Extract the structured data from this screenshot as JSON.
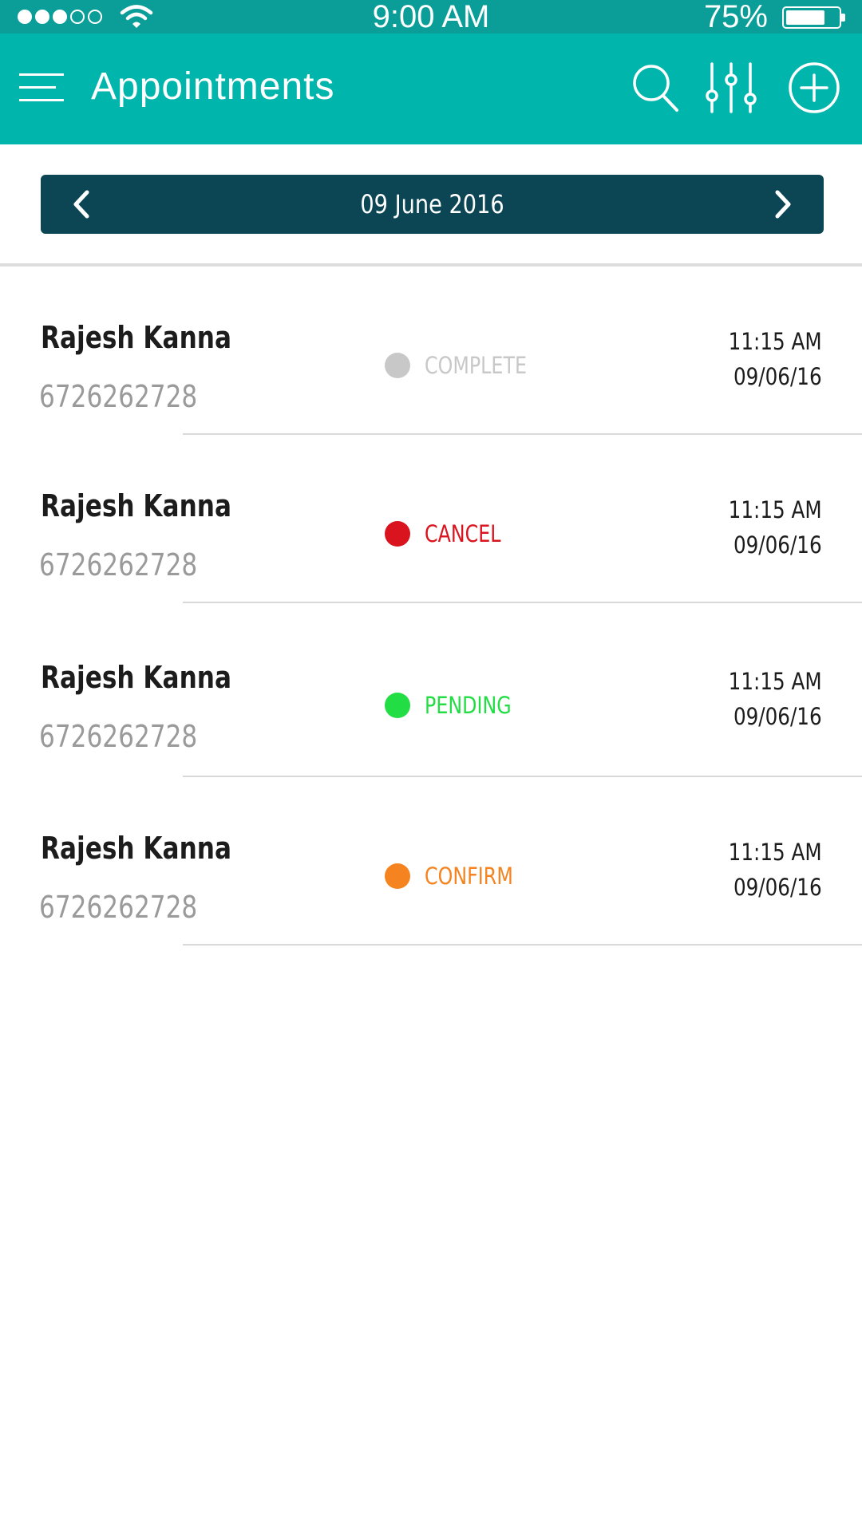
{
  "status_bar": {
    "time": "9:00 AM",
    "battery_percent": "75%",
    "battery_level": 0.75,
    "signal_bars_filled": 3,
    "signal_bars_total": 5
  },
  "app_bar": {
    "title": "Appointments",
    "icons": [
      "menu-icon",
      "search-icon",
      "filter-sliders-icon",
      "add-circle-icon"
    ],
    "background_color": "#00b5ab"
  },
  "date_nav": {
    "date": "09 June 2016",
    "background_color": "#0c4655"
  },
  "appointments": [
    {
      "name": "Rajesh Kanna",
      "phone": "6726262728",
      "status": "COMPLETE",
      "status_color": "#c8c8c8",
      "time": "11:15 AM",
      "date": "09/06/16"
    },
    {
      "name": "Rajesh Kanna",
      "phone": "6726262728",
      "status": "CANCEL",
      "status_color": "#d9141e",
      "time": "11:15 AM",
      "date": "09/06/16"
    },
    {
      "name": "Rajesh Kanna",
      "phone": "6726262728",
      "status": "PENDING",
      "status_color": "#22dd44",
      "time": "11:15 AM",
      "date": "09/06/16"
    },
    {
      "name": "Rajesh Kanna",
      "phone": "6726262728",
      "status": "CONFIRM",
      "status_color": "#f5831f",
      "time": "11:15 AM",
      "date": "09/06/16"
    }
  ]
}
